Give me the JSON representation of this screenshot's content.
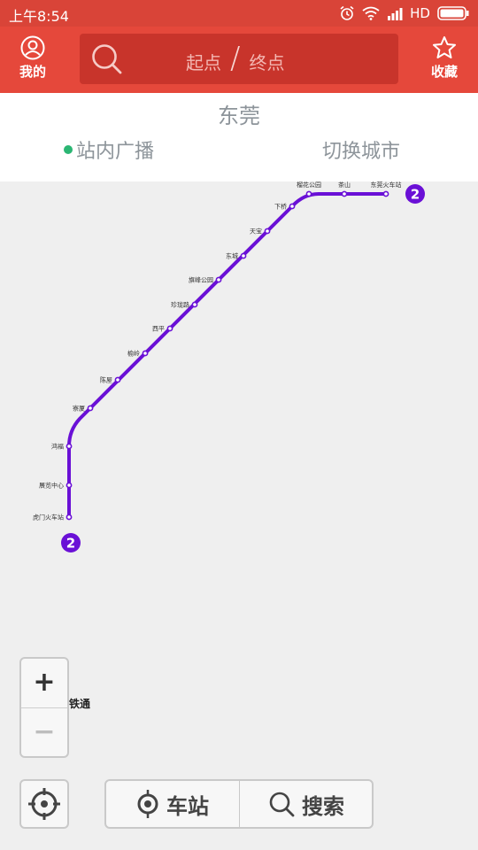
{
  "status_bar": {
    "time": "上午8:54",
    "network": "HD"
  },
  "header": {
    "profile_label": "我的",
    "start_placeholder": "起点",
    "separator": "/",
    "end_placeholder": "终点",
    "favorites_label": "收藏"
  },
  "city_bar": {
    "city": "东莞",
    "broadcast_label": "站内广播",
    "switch_city_label": "切换城市"
  },
  "map": {
    "line_color": "#6a10d6",
    "line_badge": "2",
    "stations": [
      "虎门火车站",
      "展览中心",
      "鸿福",
      "寮厦",
      "陈屋",
      "榆岭",
      "西平",
      "珍珑路",
      "旗峰公园",
      "东城",
      "天宝",
      "下桥",
      "榴花公园",
      "茶山",
      "东莞火车站"
    ]
  },
  "controls": {
    "zoom_in": "+",
    "zoom_out": "−",
    "brand_text": "铁通",
    "station_label": "车站",
    "search_label": "搜索"
  }
}
